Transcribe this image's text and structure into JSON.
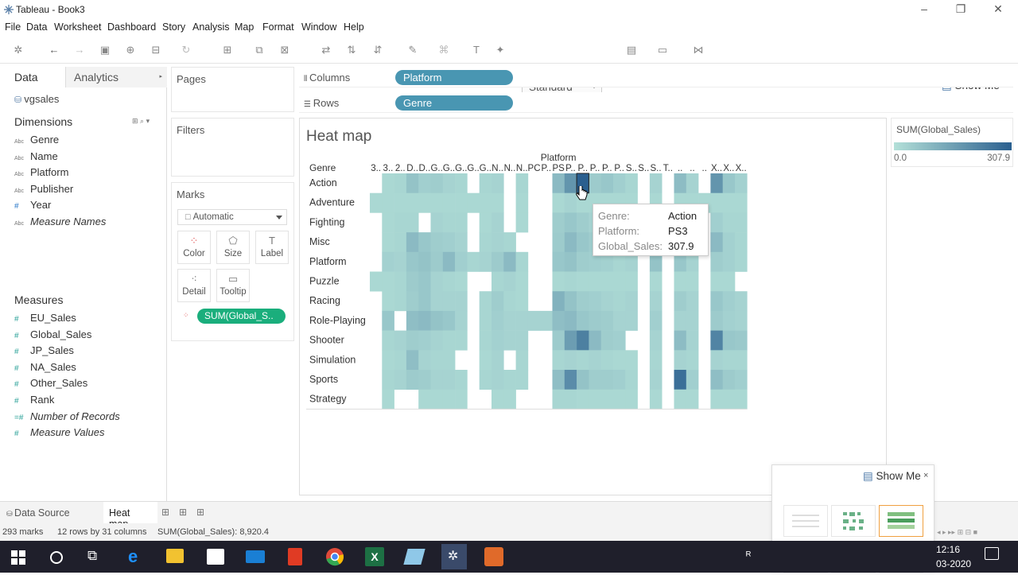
{
  "app": {
    "title": "Tableau - Book3"
  },
  "menu": [
    "File",
    "Data",
    "Worksheet",
    "Dashboard",
    "Story",
    "Analysis",
    "Map",
    "Format",
    "Window",
    "Help"
  ],
  "toolbar": {
    "fit": "Standard",
    "show_me": "Show Me"
  },
  "left_tabs": {
    "data": "Data",
    "analytics": "Analytics"
  },
  "datasource": "vgsales",
  "dimensions": {
    "title": "Dimensions",
    "items": [
      {
        "icon": "Abc",
        "label": "Genre"
      },
      {
        "icon": "Abc",
        "label": "Name"
      },
      {
        "icon": "Abc",
        "label": "Platform"
      },
      {
        "icon": "Abc",
        "label": "Publisher"
      },
      {
        "icon": "#",
        "label": "Year"
      },
      {
        "icon": "Abc",
        "label": "Measure Names"
      }
    ]
  },
  "measures": {
    "title": "Measures",
    "items": [
      {
        "icon": "#",
        "label": "EU_Sales"
      },
      {
        "icon": "#",
        "label": "Global_Sales"
      },
      {
        "icon": "#",
        "label": "JP_Sales"
      },
      {
        "icon": "#",
        "label": "NA_Sales"
      },
      {
        "icon": "#",
        "label": "Other_Sales"
      },
      {
        "icon": "#",
        "label": "Rank"
      },
      {
        "icon": "=#",
        "label": "Number of Records"
      },
      {
        "icon": "#",
        "label": "Measure Values"
      }
    ]
  },
  "cards": {
    "pages": "Pages",
    "filters": "Filters",
    "marks": "Marks"
  },
  "marks": {
    "type": "Automatic",
    "buttons": [
      {
        "label": "Color",
        "icon": "color-icon"
      },
      {
        "label": "Size",
        "icon": "size-icon"
      },
      {
        "label": "Label",
        "icon": "label-icon"
      },
      {
        "label": "Detail",
        "icon": "detail-icon"
      },
      {
        "label": "Tooltip",
        "icon": "tooltip-icon"
      }
    ],
    "pill": "SUM(Global_S.."
  },
  "shelves": {
    "columns": {
      "label": "Columns",
      "pill": "Platform"
    },
    "rows": {
      "label": "Rows",
      "pill": "Genre"
    }
  },
  "viz": {
    "title": "Heat map",
    "col_header": "Platform",
    "row_header": "Genre",
    "col_labels": [
      "3..",
      "3..",
      "2..",
      "D..",
      "D..",
      "G..",
      "G..",
      "G..",
      "G..",
      "G..",
      "N..",
      "N..",
      "N..",
      "PC",
      "P..",
      "PS",
      "P..",
      "P..",
      "P..",
      "P..",
      "P..",
      "S..",
      "S..",
      "S..",
      "T..",
      "..",
      "..",
      "..",
      "X..",
      "X..",
      "X.."
    ]
  },
  "legend": {
    "title": "SUM(Global_Sales)",
    "min": "0.0",
    "max": "307.9",
    "color_low": "#b3e0d8",
    "color_high": "#2a5f8f"
  },
  "tooltip": [
    {
      "k": "Genre:",
      "v": "Action"
    },
    {
      "k": "Platform:",
      "v": "PS3"
    },
    {
      "k": "Global_Sales:",
      "v": "307.9"
    }
  ],
  "chart_data": {
    "type": "heatmap",
    "title": "Heat map",
    "xlabel": "Platform",
    "ylabel": "Genre",
    "rows": [
      "Action",
      "Adventure",
      "Fighting",
      "Misc",
      "Platform",
      "Puzzle",
      "Racing",
      "Role-Playing",
      "Shooter",
      "Simulation",
      "Sports",
      "Strategy"
    ],
    "columns_count": 31,
    "color_range": [
      0,
      307.9
    ],
    "values": [
      [
        null,
        20,
        25,
        70,
        40,
        45,
        30,
        25,
        null,
        25,
        30,
        null,
        25,
        null,
        null,
        90,
        180,
        307.9,
        50,
        60,
        40,
        25,
        null,
        30,
        null,
        85,
        30,
        null,
        180,
        60,
        35
      ],
      [
        20,
        20,
        20,
        20,
        20,
        20,
        20,
        20,
        20,
        20,
        20,
        null,
        20,
        null,
        null,
        20,
        30,
        20,
        20,
        20,
        20,
        20,
        null,
        20,
        null,
        20,
        20,
        20,
        20,
        20,
        20
      ],
      [
        null,
        20,
        25,
        25,
        null,
        30,
        25,
        25,
        null,
        20,
        30,
        null,
        20,
        null,
        null,
        45,
        60,
        45,
        30,
        25,
        25,
        null,
        null,
        20,
        null,
        30,
        null,
        null,
        40,
        25,
        25
      ],
      [
        null,
        20,
        25,
        90,
        60,
        45,
        40,
        30,
        null,
        25,
        30,
        25,
        null,
        null,
        null,
        50,
        90,
        60,
        45,
        40,
        30,
        25,
        null,
        30,
        null,
        30,
        25,
        null,
        90,
        35,
        25
      ],
      [
        null,
        35,
        30,
        60,
        70,
        50,
        90,
        40,
        25,
        30,
        50,
        90,
        25,
        null,
        null,
        60,
        70,
        45,
        40,
        35,
        25,
        30,
        null,
        70,
        null,
        60,
        30,
        null,
        45,
        35,
        25
      ],
      [
        20,
        20,
        25,
        50,
        60,
        30,
        25,
        20,
        null,
        null,
        25,
        30,
        20,
        null,
        null,
        20,
        25,
        20,
        20,
        20,
        20,
        20,
        null,
        20,
        null,
        20,
        20,
        null,
        20,
        20,
        null
      ],
      [
        null,
        20,
        25,
        45,
        60,
        30,
        30,
        30,
        null,
        25,
        45,
        25,
        20,
        null,
        null,
        110,
        70,
        45,
        40,
        30,
        25,
        30,
        null,
        30,
        null,
        45,
        30,
        null,
        60,
        40,
        30
      ],
      [
        null,
        60,
        null,
        80,
        90,
        70,
        60,
        30,
        null,
        25,
        40,
        30,
        30,
        30,
        30,
        80,
        90,
        60,
        50,
        45,
        30,
        30,
        null,
        40,
        null,
        30,
        30,
        null,
        50,
        35,
        30
      ],
      [
        null,
        25,
        30,
        45,
        40,
        30,
        25,
        25,
        null,
        25,
        35,
        30,
        30,
        null,
        null,
        50,
        160,
        230,
        90,
        45,
        40,
        null,
        null,
        30,
        null,
        85,
        30,
        null,
        220,
        60,
        55
      ],
      [
        null,
        20,
        25,
        80,
        30,
        25,
        25,
        null,
        null,
        20,
        30,
        null,
        25,
        null,
        null,
        25,
        30,
        25,
        30,
        25,
        20,
        20,
        null,
        25,
        null,
        30,
        25,
        null,
        30,
        25,
        25
      ],
      [
        null,
        25,
        30,
        50,
        45,
        30,
        30,
        25,
        null,
        25,
        30,
        25,
        25,
        null,
        null,
        80,
        200,
        70,
        45,
        45,
        40,
        25,
        null,
        30,
        null,
        270,
        40,
        null,
        80,
        50,
        40
      ],
      [
        null,
        20,
        null,
        null,
        20,
        20,
        20,
        20,
        null,
        null,
        20,
        20,
        null,
        null,
        null,
        25,
        25,
        20,
        20,
        20,
        20,
        20,
        null,
        20,
        null,
        20,
        20,
        null,
        20,
        20,
        20
      ]
    ]
  },
  "bottom": {
    "data_source": "Data Source",
    "sheet": "Heat map"
  },
  "status": {
    "marks": "293 marks",
    "dims": "12 rows by 31 columns",
    "sum": "SUM(Global_Sales): 8,920.4"
  },
  "showme_panel": {
    "title": "Show Me"
  },
  "clock": {
    "time": "12:16",
    "date": "03-2020"
  }
}
